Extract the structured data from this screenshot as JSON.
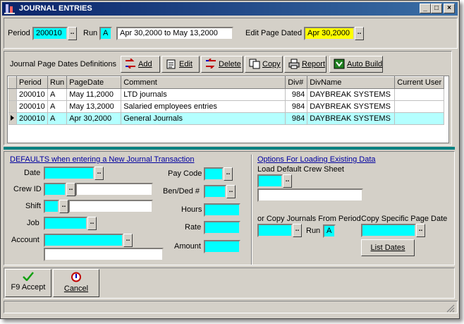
{
  "window": {
    "title": "JOURNAL ENTRIES"
  },
  "top": {
    "period_label": "Period",
    "period_value": "200010",
    "run_label": "Run",
    "run_value": "A",
    "date_range": "Apr 30,2000  to  May 13,2000",
    "edit_page_dated_label": "Edit Page Dated",
    "edit_page_dated_value": "Apr 30,2000"
  },
  "toolbar": {
    "title": "Journal Page Dates Definitions",
    "add": "Add",
    "edit": "Edit",
    "delete": "Delete",
    "copy": "Copy",
    "report": "Report",
    "auto_build": "Auto Build"
  },
  "grid": {
    "headers": [
      "Period",
      "Run",
      "PageDate",
      "Comment",
      "Div#",
      "DivName",
      "Current User"
    ],
    "rows": [
      [
        "200010",
        "A",
        "May 11,2000",
        "LTD journals",
        "984",
        "DAYBREAK SYSTEMS",
        ""
      ],
      [
        "200010",
        "A",
        "May 13,2000",
        "Salaried employees entries",
        "984",
        "DAYBREAK SYSTEMS",
        ""
      ],
      [
        "200010",
        "A",
        "Apr 30,2000",
        "General Journals",
        "984",
        "DAYBREAK SYSTEMS",
        ""
      ]
    ],
    "selected_row": 2
  },
  "defaults": {
    "heading": "DEFAULTS when entering a New Journal Transaction",
    "date": "Date",
    "crew_id": "Crew ID",
    "shift": "Shift",
    "job": "Job",
    "account": "Account",
    "pay_code": "Pay Code",
    "ben_ded": "Ben/Ded #",
    "hours": "Hours",
    "rate": "Rate",
    "amount": "Amount"
  },
  "options": {
    "heading": "Options For Loading Existing Data",
    "load_default_crew_sheet": "Load Default Crew Sheet",
    "copy_from_period": "or Copy Journals From Period",
    "run_label": "Run",
    "run_value": "A",
    "copy_page_date": "Copy Specific Page Date",
    "list_dates": "List Dates"
  },
  "footer": {
    "accept": "F9 Accept",
    "cancel": "Cancel"
  }
}
